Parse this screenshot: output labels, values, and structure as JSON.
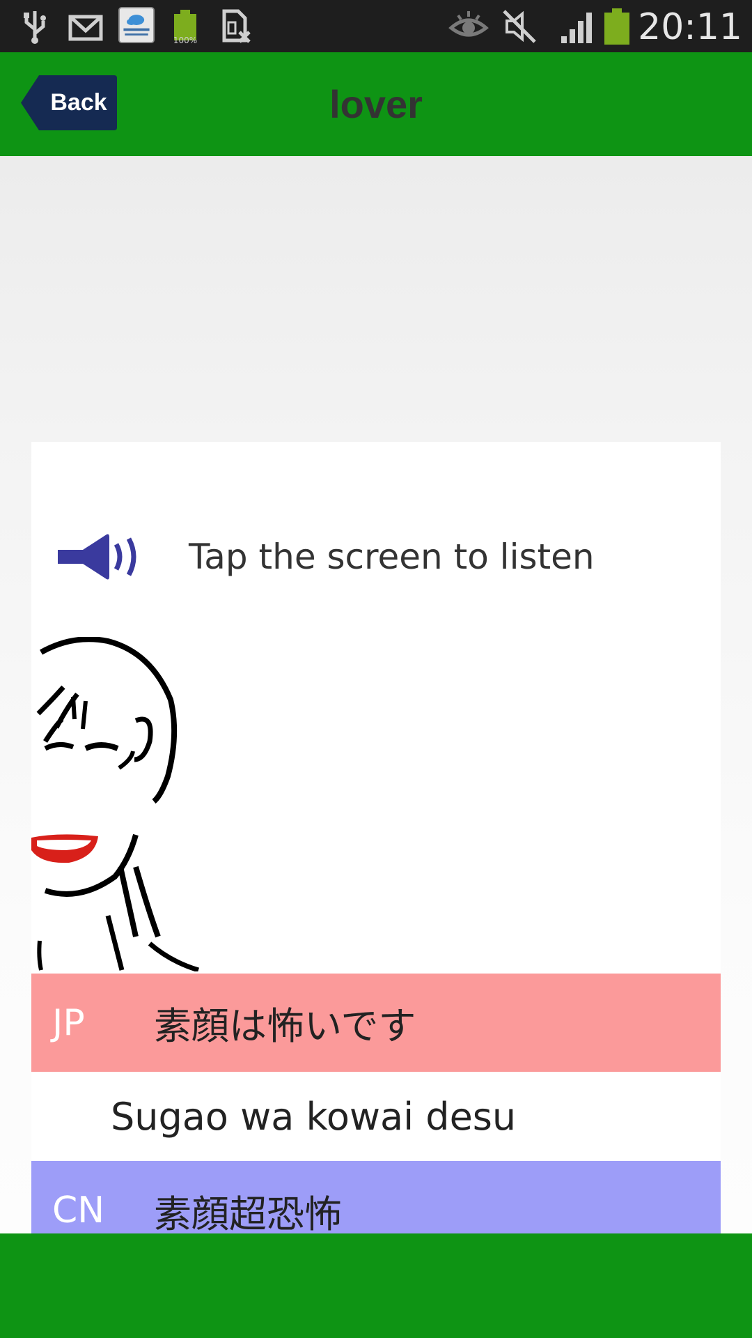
{
  "status_bar": {
    "time": "20:11",
    "battery_small_label": "100%",
    "icons": [
      "usb-icon",
      "gmail-icon",
      "cloud-testing-app-icon",
      "battery-full-icon",
      "sim-missing-icon",
      "eye-icon",
      "mute-icon",
      "signal-icon",
      "battery-icon"
    ]
  },
  "header": {
    "back_label": "Back",
    "title": "lover"
  },
  "card": {
    "listen_hint": "Tap the screen to listen",
    "jp_tag": "JP",
    "jp_text": "素顔は怖いです",
    "romaji": "Sugao wa kowai desu",
    "cn_tag": "CN",
    "cn_text": "素顔超恐怖"
  },
  "colors": {
    "header": "#0e9414",
    "jp_row": "#fb9a9a",
    "cn_row": "#9d9df8",
    "back_button": "#152a52",
    "speaker": "#3a3a9e"
  }
}
